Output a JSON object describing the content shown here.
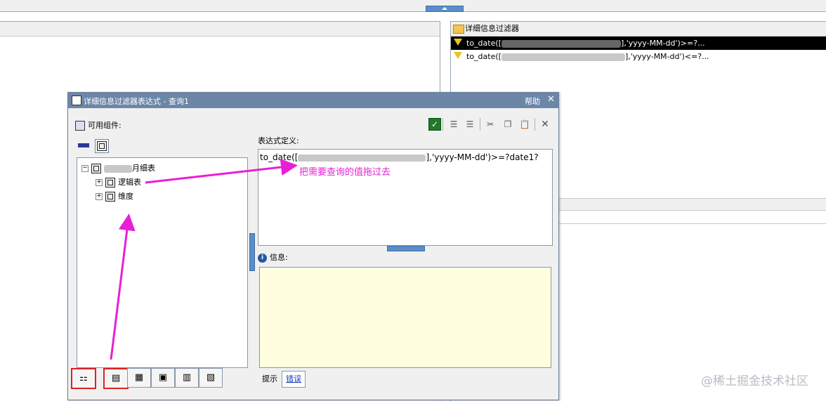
{
  "detail_filter_panel": {
    "title": "详细信息过滤器",
    "filters": [
      {
        "text_pre": "to_date([",
        "text_post": "],'yyyy-MM-dd')>=?...",
        "selected": true
      },
      {
        "text_pre": "to_date([",
        "text_post": "],'yyyy-MM-dd')<=?...",
        "selected": false
      }
    ]
  },
  "dialog": {
    "title": "详细信息过滤器表达式 - 查询1",
    "help_label": "帮助",
    "close_label": "✕",
    "available_components_label": "可用组件:",
    "tree": {
      "root_prefix": "",
      "root_suffix": "月细表",
      "children": [
        "逻辑表",
        "维度"
      ]
    },
    "expression_label": "表达式定义:",
    "expression": {
      "text_pre": "to_date([",
      "text_post": "],'yyyy-MM-dd')>=?date1?"
    },
    "info_label": "信息:",
    "info_tabs": [
      "提示",
      "错误"
    ]
  },
  "annotation_text": "把需要查询的值拖过去",
  "watermark": "@稀土掘金技术社区",
  "colors": {
    "annotation": "#e81fd5",
    "highlight_box": "#e02020",
    "titlebar": "#6c86a8",
    "info_bg": "#ffffe0"
  }
}
